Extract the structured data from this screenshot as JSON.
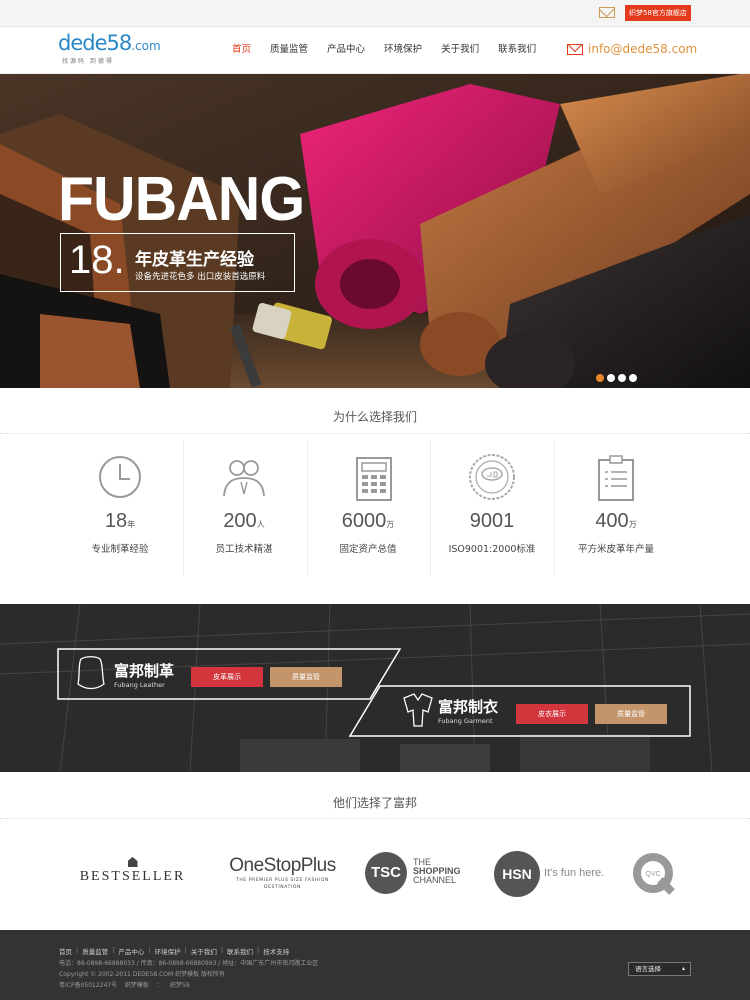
{
  "topbar": {
    "flagship_label": "织梦58官方旗舰店"
  },
  "header": {
    "logo_main": "dede58",
    "logo_domain": ".com",
    "logo_sub": "找源码 到德得",
    "nav": [
      {
        "label": "首页",
        "active": true
      },
      {
        "label": "质量监管"
      },
      {
        "label": "产品中心"
      },
      {
        "label": "环境保护"
      },
      {
        "label": "关于我们"
      },
      {
        "label": "联系我们"
      }
    ],
    "email": "info@dede58.com"
  },
  "banner": {
    "title": "FUBANG",
    "number": "18.",
    "line1": "年皮革生产经验",
    "line2": "设备先进花色多 出口皮装首选原料",
    "slides": 4,
    "active_slide": 1
  },
  "why": {
    "title": "为什么选择我们",
    "stats": [
      {
        "icon": "clock-icon",
        "num": "18",
        "unit": "年",
        "label": "专业制革经验"
      },
      {
        "icon": "people-icon",
        "num": "200",
        "unit": "人",
        "label": "员工技术精湛"
      },
      {
        "icon": "calculator-icon",
        "num": "6000",
        "unit": "万",
        "label": "固定资产总值"
      },
      {
        "icon": "iso-seal-icon",
        "num": "9001",
        "unit": "",
        "label": "ISO9001:2000标准"
      },
      {
        "icon": "clipboard-icon",
        "num": "400",
        "unit": "万",
        "label": "平方米皮革年产量"
      }
    ]
  },
  "factory": {
    "leather": {
      "title": "富邦制革",
      "sub": "Fubang Leather",
      "btn1": "皮革展示",
      "btn2": "质量监管"
    },
    "garment": {
      "title": "富邦制衣",
      "sub": "Fubang Garment",
      "btn1": "皮衣展示",
      "btn2": "质量监管"
    }
  },
  "clients": {
    "title": "他们选择了富邦",
    "logos": [
      {
        "name": "BESTSELLER"
      },
      {
        "name": "OneStopPlus",
        "tagline": "THE PREMIER PLUS SIZE FASHION DESTINATION"
      },
      {
        "name": "TSC",
        "line1": "THE",
        "line2": "SHOPPING",
        "line3": "CHANNEL"
      },
      {
        "name": "HSN",
        "tagline": "It's fun here."
      },
      {
        "name": "QVC"
      }
    ]
  },
  "footer": {
    "links": [
      "首页",
      "质量监管",
      "产品中心",
      "环境保护",
      "关于我们",
      "联系我们",
      "技术支持"
    ],
    "contact": "电话：86-0898-66888033 / 传真：86-0898-66880993 / 地址：中国广东广州市南河路工业区",
    "copyright": "Copyright © 2002-2011 DEDE58.COM 织梦模板 版权所有",
    "icp": "粤ICP备05012247号    织梦模板    ：    织梦58",
    "language": "语言选择"
  },
  "colors": {
    "accent": "#e4391b",
    "email": "#e0913e",
    "dot_active": "#e88a2c",
    "btn_red": "#d2353b",
    "btn_tan": "#c4956a",
    "footer_bg": "#333333"
  }
}
